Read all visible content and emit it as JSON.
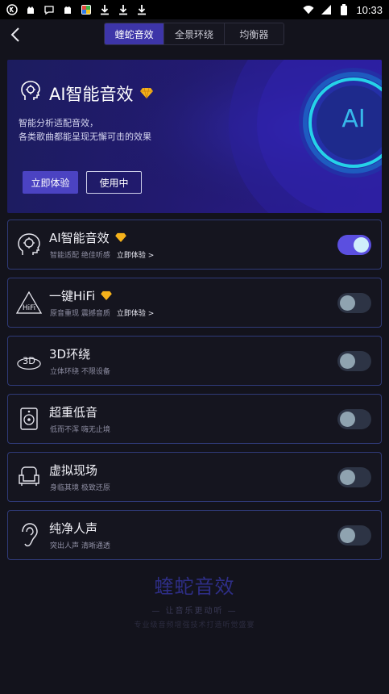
{
  "status_bar": {
    "left_icons": [
      "k-badge-icon",
      "gesture-icon",
      "chat-icon",
      "hand-icon",
      "gallery-icon",
      "download-icon",
      "download-icon",
      "download-icon"
    ],
    "right_icons": [
      "wifi-icon",
      "signal-icon",
      "battery-icon"
    ],
    "time": "10:33"
  },
  "header": {
    "tabs": [
      {
        "label": "蝰蛇音效",
        "active": true
      },
      {
        "label": "全景环绕",
        "active": false
      },
      {
        "label": "均衡器",
        "active": false
      }
    ]
  },
  "banner": {
    "title": "AI智能音效",
    "desc_line1": "智能分析适配音效，",
    "desc_line2": "各类歌曲都能呈现无懈可击的效果",
    "try_button": "立即体验",
    "in_use_button": "使用中",
    "orb_text": "AI"
  },
  "cards": [
    {
      "title": "AI智能音效",
      "subtitle": "智能适配 绝佳听感",
      "link": "立即体验 >",
      "premium": true,
      "on": true,
      "icon": "ai-head-icon"
    },
    {
      "title": "一键HiFi",
      "subtitle": "原音重现 震撼音质",
      "link": "立即体验 >",
      "premium": true,
      "on": false,
      "icon": "hifi-icon"
    },
    {
      "title": "3D环绕",
      "subtitle": "立体环绕 不限设备",
      "link": "",
      "premium": false,
      "on": false,
      "icon": "3d-icon"
    },
    {
      "title": "超重低音",
      "subtitle": "低而不浑 嗨无止境",
      "link": "",
      "premium": false,
      "on": false,
      "icon": "speaker-icon"
    },
    {
      "title": "虚拟现场",
      "subtitle": "身临其境 极致还原",
      "link": "",
      "premium": false,
      "on": false,
      "icon": "armchair-icon"
    },
    {
      "title": "纯净人声",
      "subtitle": "突出人声 清晰通透",
      "link": "",
      "premium": false,
      "on": false,
      "icon": "ear-icon"
    }
  ],
  "footer": {
    "brand": "蝰蛇音效",
    "slogan": "— 让音乐更动听 —",
    "tagline": "专业级音频增强技术打造听觉盛宴"
  },
  "colors": {
    "accent": "#4b43c2",
    "toggle_on": "#5b4fe0",
    "card_border": "#2f3a78",
    "gem": "#f5b21b",
    "orb": "#25d2e8"
  }
}
